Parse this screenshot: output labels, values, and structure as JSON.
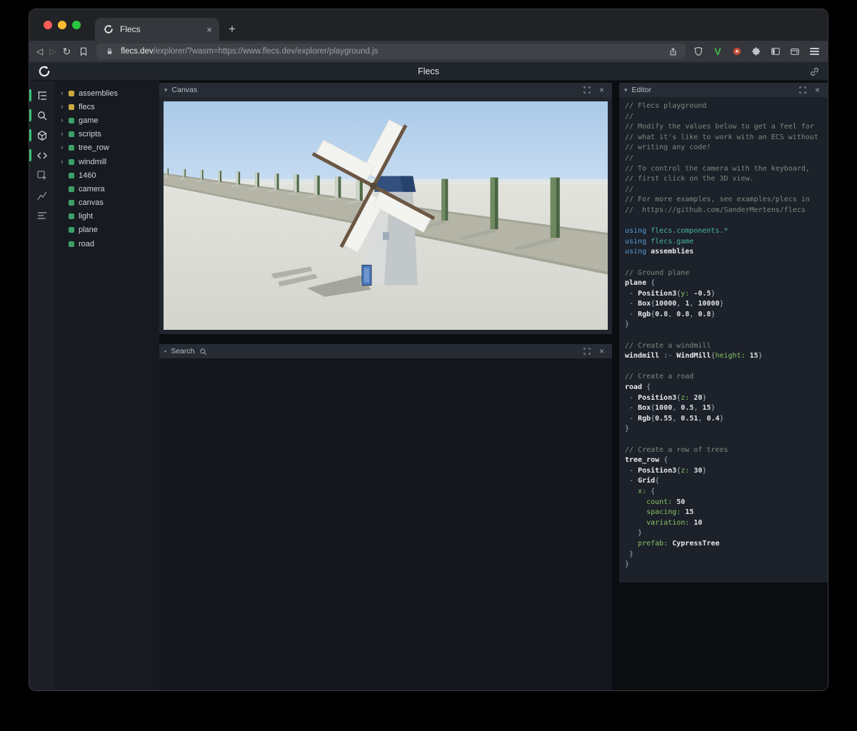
{
  "glyphs": {
    "close": "×",
    "plus": "+",
    "back": "◁",
    "forward": "▷",
    "reload": "↻",
    "chevron_down": "▾",
    "chevron_right": "›",
    "bullet": "▪"
  },
  "browser": {
    "tab_title": "Flecs",
    "url_host": "flecs.dev",
    "url_rest": "/explorer/?wasm=https://www.flecs.dev/explorer/playground.js",
    "extension_v": "V"
  },
  "header": {
    "title": "Flecs"
  },
  "panels": {
    "canvas": "Canvas",
    "search": "Search",
    "editor": "Editor"
  },
  "rail": {
    "items": [
      "entity-tree",
      "search",
      "canvas-3d",
      "editor",
      "inspect",
      "charts",
      "stats"
    ]
  },
  "tree": {
    "items": [
      {
        "label": "assemblies",
        "dot": "yellow",
        "expandable": true
      },
      {
        "label": "flecs",
        "dot": "yellow",
        "expandable": true
      },
      {
        "label": "game",
        "dot": "green",
        "expandable": true
      },
      {
        "label": "scripts",
        "dot": "green",
        "expandable": true
      },
      {
        "label": "tree_row",
        "dot": "green",
        "expandable": true
      },
      {
        "label": "windmill",
        "dot": "green",
        "expandable": true
      },
      {
        "label": "1460",
        "dot": "green",
        "expandable": false
      },
      {
        "label": "camera",
        "dot": "green",
        "expandable": false
      },
      {
        "label": "canvas",
        "dot": "green",
        "expandable": false
      },
      {
        "label": "light",
        "dot": "green",
        "expandable": false
      },
      {
        "label": "plane",
        "dot": "green",
        "expandable": false
      },
      {
        "label": "road",
        "dot": "green",
        "expandable": false
      }
    ]
  },
  "editor": {
    "lines": [
      [
        [
          "// Flecs playground",
          "cm"
        ]
      ],
      [
        [
          "//",
          "cm"
        ]
      ],
      [
        [
          "// Modify the values below to get a feel for",
          "cm"
        ]
      ],
      [
        [
          "// what it's like to work with an ECS without",
          "cm"
        ]
      ],
      [
        [
          "// writing any code!",
          "cm"
        ]
      ],
      [
        [
          "//",
          "cm"
        ]
      ],
      [
        [
          "// To control the camera with the keyboard,",
          "cm"
        ]
      ],
      [
        [
          "// first click on the 3D view.",
          "cm"
        ]
      ],
      [
        [
          "//",
          "cm"
        ]
      ],
      [
        [
          "// For more examples, see examples/plecs in",
          "cm"
        ]
      ],
      [
        [
          "//  https://github.com/SanderMertens/flecs",
          "cm"
        ]
      ],
      [],
      [
        [
          "using ",
          "kw"
        ],
        [
          "flecs.components.*",
          "mod"
        ]
      ],
      [
        [
          "using ",
          "kw"
        ],
        [
          "flecs.game",
          "mod"
        ]
      ],
      [
        [
          "using ",
          "kw"
        ],
        [
          "assemblies",
          "b"
        ]
      ],
      [],
      [
        [
          "// Ground plane",
          "cm"
        ]
      ],
      [
        [
          "plane",
          "b"
        ],
        [
          " {",
          "pl"
        ]
      ],
      [
        [
          " - ",
          "pl"
        ],
        [
          "Position3",
          "b"
        ],
        [
          "{",
          "pl"
        ],
        [
          "y:",
          "pr"
        ],
        [
          " ",
          "pl"
        ],
        [
          "-0.5",
          "nm"
        ],
        [
          "}",
          "pl"
        ]
      ],
      [
        [
          " - ",
          "pl"
        ],
        [
          "Box",
          "b"
        ],
        [
          "{",
          "pl"
        ],
        [
          "10000",
          "nm"
        ],
        [
          ", ",
          "pl"
        ],
        [
          "1",
          "nm"
        ],
        [
          ", ",
          "pl"
        ],
        [
          "10000",
          "nm"
        ],
        [
          "}",
          "pl"
        ]
      ],
      [
        [
          " - ",
          "pl"
        ],
        [
          "Rgb",
          "b"
        ],
        [
          "{",
          "pl"
        ],
        [
          "0.8",
          "nm"
        ],
        [
          ", ",
          "pl"
        ],
        [
          "0.8",
          "nm"
        ],
        [
          ", ",
          "pl"
        ],
        [
          "0.8",
          "nm"
        ],
        [
          "}",
          "pl"
        ]
      ],
      [
        [
          "}",
          "pl"
        ]
      ],
      [],
      [
        [
          "// Create a windmill",
          "cm"
        ]
      ],
      [
        [
          "windmill",
          "b"
        ],
        [
          " :- ",
          "pl"
        ],
        [
          "WindMill",
          "b"
        ],
        [
          "{",
          "pl"
        ],
        [
          "height:",
          "pr"
        ],
        [
          " ",
          "pl"
        ],
        [
          "15",
          "nm"
        ],
        [
          "}",
          "pl"
        ]
      ],
      [],
      [
        [
          "// Create a road",
          "cm"
        ]
      ],
      [
        [
          "road",
          "b"
        ],
        [
          " {",
          "pl"
        ]
      ],
      [
        [
          " - ",
          "pl"
        ],
        [
          "Position3",
          "b"
        ],
        [
          "{",
          "pl"
        ],
        [
          "z:",
          "pr"
        ],
        [
          " ",
          "pl"
        ],
        [
          "20",
          "nm"
        ],
        [
          "}",
          "pl"
        ]
      ],
      [
        [
          " - ",
          "pl"
        ],
        [
          "Box",
          "b"
        ],
        [
          "{",
          "pl"
        ],
        [
          "1000",
          "nm"
        ],
        [
          ", ",
          "pl"
        ],
        [
          "0.5",
          "nm"
        ],
        [
          ", ",
          "pl"
        ],
        [
          "15",
          "nm"
        ],
        [
          "}",
          "pl"
        ]
      ],
      [
        [
          " - ",
          "pl"
        ],
        [
          "Rgb",
          "b"
        ],
        [
          "{",
          "pl"
        ],
        [
          "0.55",
          "nm"
        ],
        [
          ", ",
          "pl"
        ],
        [
          "0.51",
          "nm"
        ],
        [
          ", ",
          "pl"
        ],
        [
          "0.4",
          "nm"
        ],
        [
          "}",
          "pl"
        ]
      ],
      [
        [
          "}",
          "pl"
        ]
      ],
      [],
      [
        [
          "// Create a row of trees",
          "cm"
        ]
      ],
      [
        [
          "tree_row",
          "b"
        ],
        [
          " {",
          "pl"
        ]
      ],
      [
        [
          " - ",
          "pl"
        ],
        [
          "Position3",
          "b"
        ],
        [
          "{",
          "pl"
        ],
        [
          "z:",
          "pr"
        ],
        [
          " ",
          "pl"
        ],
        [
          "30",
          "nm"
        ],
        [
          "}",
          "pl"
        ]
      ],
      [
        [
          " - ",
          "pl"
        ],
        [
          "Grid",
          "b"
        ],
        [
          "{",
          "pl"
        ]
      ],
      [
        [
          "   ",
          "pl"
        ],
        [
          "x:",
          "pr"
        ],
        [
          " {",
          "pl"
        ]
      ],
      [
        [
          "     ",
          "pl"
        ],
        [
          "count:",
          "pr"
        ],
        [
          " ",
          "pl"
        ],
        [
          "50",
          "nm"
        ]
      ],
      [
        [
          "     ",
          "pl"
        ],
        [
          "spacing:",
          "pr"
        ],
        [
          " ",
          "pl"
        ],
        [
          "15",
          "nm"
        ]
      ],
      [
        [
          "     ",
          "pl"
        ],
        [
          "variation:",
          "pr"
        ],
        [
          " ",
          "pl"
        ],
        [
          "10",
          "nm"
        ]
      ],
      [
        [
          "   }",
          "pl"
        ]
      ],
      [
        [
          "   ",
          "pl"
        ],
        [
          "prefab:",
          "pr"
        ],
        [
          " ",
          "pl"
        ],
        [
          "CypressTree",
          "b"
        ]
      ],
      [
        [
          " }",
          "pl"
        ]
      ],
      [
        [
          "}",
          "pl"
        ]
      ]
    ]
  },
  "colors": {
    "accent_green": "#3fbf77",
    "entity_green": "#3da066",
    "entity_yellow": "#c9a83f",
    "sky": "#b7d2eb",
    "ground": "#dcddd6",
    "road": "#b5b5a7"
  }
}
